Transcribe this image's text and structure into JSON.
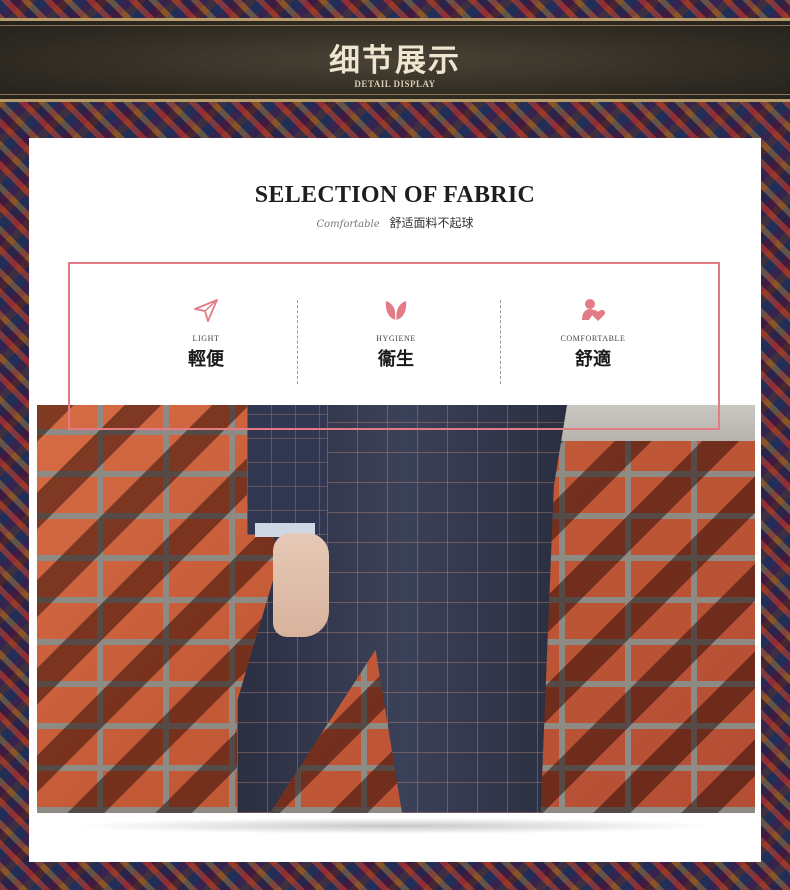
{
  "banner": {
    "title": "细节展示",
    "subtitle": "DETAIL DISPLAY"
  },
  "section": {
    "heading": "SELECTION OF FABRIC",
    "tagline_script": "Comfortable",
    "tagline": "舒适面料不起球"
  },
  "features": [
    {
      "icon": "paper-plane-icon",
      "en": "LIGHT",
      "zh": "輕便"
    },
    {
      "icon": "leaf-icon",
      "en": "HYGIENE",
      "zh": "衞生"
    },
    {
      "icon": "person-heart-icon",
      "en": "COMFORTABLE",
      "zh": "舒適"
    }
  ],
  "colors": {
    "accent": "#e27b86",
    "banner_bg": "#2e2a22",
    "banner_trim": "#b89d6a"
  }
}
